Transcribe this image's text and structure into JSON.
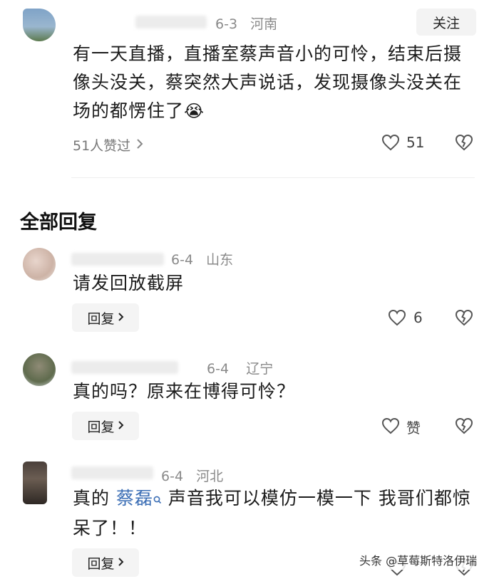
{
  "main_comment": {
    "date": "6-3",
    "location": "河南",
    "follow_label": "关注",
    "text": "有一天直播，直播室蔡声音小的可怜，结束后摄像头没关，蔡突然大声说话，发现摄像头没关在场的都愣住了",
    "emoji": "😭",
    "likers_label": "51人赞过",
    "like_count": "51"
  },
  "section_title": "全部回复",
  "replies": [
    {
      "date": "6-4",
      "location": "山东",
      "text": "请发回放截屏",
      "reply_label": "回复",
      "like_count": "6"
    },
    {
      "date": "6-4",
      "location": "辽宁",
      "text": "真的吗？原来在博得可怜？",
      "reply_label": "回复",
      "like_label": "赞"
    },
    {
      "date": "6-4",
      "location": "河北",
      "text_pre": "真的 ",
      "mention": "蔡磊",
      "text_post": " 声音我可以模仿一模一下 我哥们都惊呆了！！",
      "reply_label": "回复"
    }
  ],
  "watermark": "头条 @草莓斯特洛伊瑞",
  "colors": {
    "mention": "#3b6eb5",
    "meta": "#8a8a8a",
    "button_bg": "#f4f4f4"
  }
}
